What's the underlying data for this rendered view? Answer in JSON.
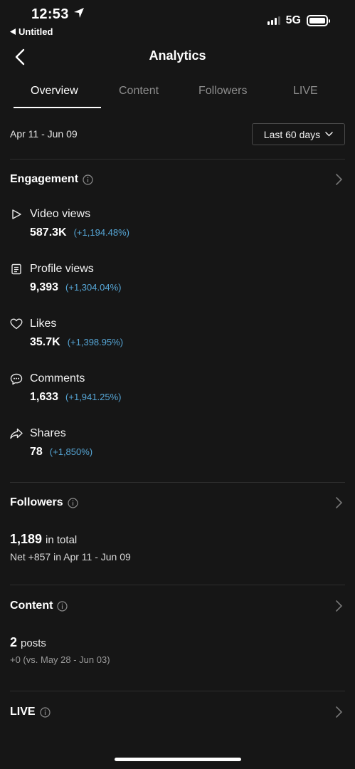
{
  "status_bar": {
    "time": "12:53",
    "back_app_label": "Untitled",
    "network": "5G"
  },
  "header": {
    "title": "Analytics"
  },
  "tabs": [
    {
      "label": "Overview",
      "active": true
    },
    {
      "label": "Content",
      "active": false
    },
    {
      "label": "Followers",
      "active": false
    },
    {
      "label": "LIVE",
      "active": false
    }
  ],
  "date_range": {
    "label": "Apr 11 - Jun 09",
    "selector": "Last 60 days"
  },
  "engagement": {
    "title": "Engagement",
    "metrics": [
      {
        "icon": "play-icon",
        "label": "Video views",
        "value": "587.3K",
        "change": "(+1,194.48%)"
      },
      {
        "icon": "profile-icon",
        "label": "Profile views",
        "value": "9,393",
        "change": "(+1,304.04%)"
      },
      {
        "icon": "heart-icon",
        "label": "Likes",
        "value": "35.7K",
        "change": "(+1,398.95%)"
      },
      {
        "icon": "comment-icon",
        "label": "Comments",
        "value": "1,633",
        "change": "(+1,941.25%)"
      },
      {
        "icon": "share-icon",
        "label": "Shares",
        "value": "78",
        "change": "(+1,850%)"
      }
    ]
  },
  "followers": {
    "title": "Followers",
    "total_value": "1,189",
    "total_suffix": "in total",
    "net_text": "Net +857 in Apr 11 - Jun 09"
  },
  "content": {
    "title": "Content",
    "posts_value": "2",
    "posts_suffix": "posts",
    "compare_text": "+0 (vs. May 28 - Jun 03)"
  },
  "live": {
    "title": "LIVE"
  },
  "colors": {
    "background": "#161616",
    "change_accent": "#56a6d6",
    "divider": "#2e2e2e"
  }
}
